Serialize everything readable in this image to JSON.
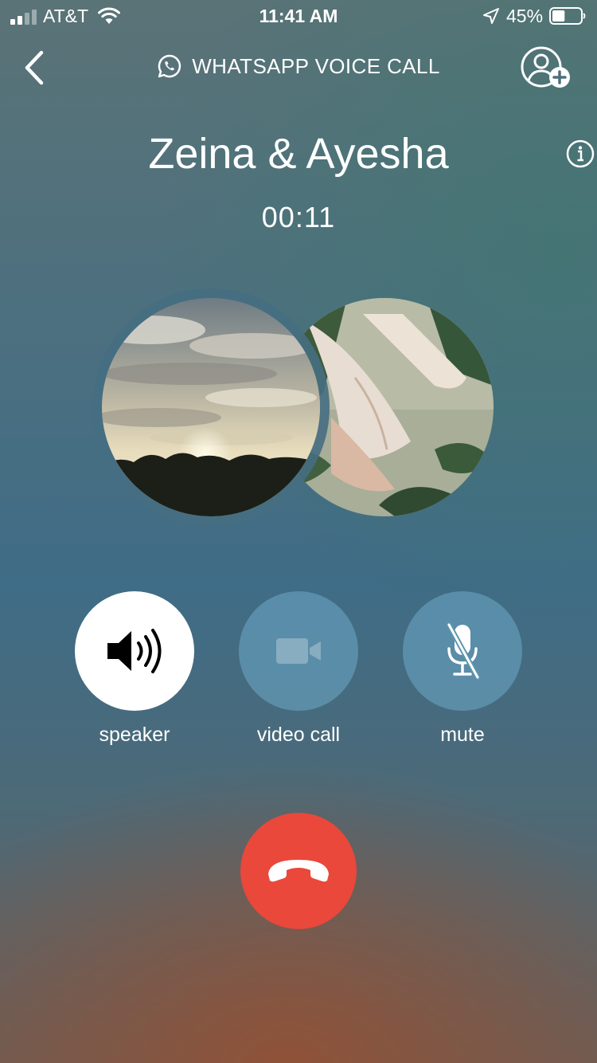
{
  "status_bar": {
    "carrier": "AT&T",
    "time": "11:41 AM",
    "battery_percent": "45%",
    "signal_bars": 2,
    "battery_level": 0.45
  },
  "header": {
    "title": "WHATSAPP VOICE CALL",
    "back_icon": "chevron-left-icon",
    "add_participant_icon": "add-person-icon"
  },
  "call": {
    "name": "Zeina & Ayesha",
    "duration": "00:11"
  },
  "participants": [
    {
      "avatar": "sunset-photo"
    },
    {
      "avatar": "flower-photo"
    }
  ],
  "controls": {
    "speaker": {
      "label": "speaker",
      "icon": "speaker-icon",
      "active": true
    },
    "video": {
      "label": "video call",
      "icon": "video-camera-icon",
      "active": false
    },
    "mute": {
      "label": "mute",
      "icon": "microphone-muted-icon",
      "active": false
    }
  },
  "end_call": {
    "icon": "phone-hangup-icon",
    "color": "#e9483b"
  },
  "colors": {
    "end_call": "#e9483b",
    "control_inactive": "rgba(110,170,200,0.55)",
    "control_active": "#ffffff"
  }
}
